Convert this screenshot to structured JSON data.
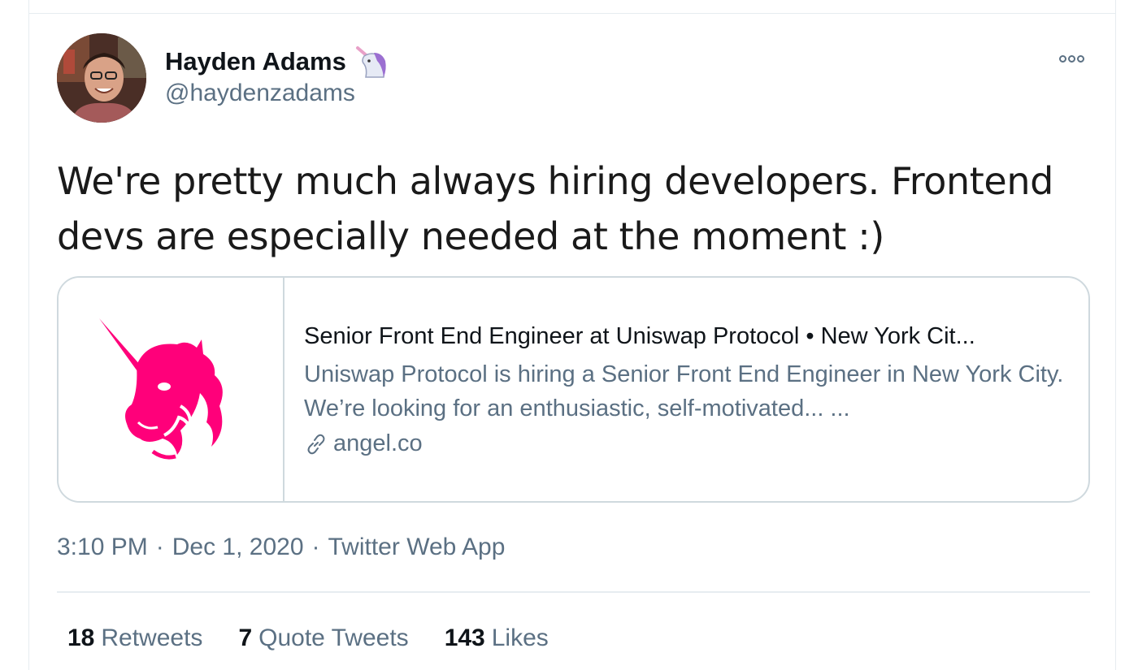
{
  "author": {
    "name": "Hayden Adams",
    "handle": "@haydenzadams",
    "badge_icon": "unicorn-emoji-icon"
  },
  "tweet": {
    "text": "We're pretty much always hiring developers. Frontend devs are especially needed at the moment :)"
  },
  "card": {
    "title": "Senior Front End Engineer at Uniswap Protocol • New York Cit...",
    "description": "Uniswap Protocol is hiring a Senior Front End Engineer in New York City. We’re looking for an enthusiastic, self-motivated... ...",
    "domain": "angel.co",
    "image_icon": "uniswap-unicorn-logo",
    "accent_color": "#ff007a"
  },
  "meta": {
    "time": "3:10 PM",
    "separator": "·",
    "date": "Dec 1, 2020",
    "source": "Twitter Web App"
  },
  "stats": {
    "retweets_count": "18",
    "retweets_label": "Retweets",
    "quotes_count": "7",
    "quotes_label": "Quote Tweets",
    "likes_count": "143",
    "likes_label": "Likes"
  },
  "colors": {
    "text_primary": "#0f1419",
    "text_secondary": "#5b7083",
    "border": "#cfd9de",
    "brand_pink": "#ff007a"
  }
}
